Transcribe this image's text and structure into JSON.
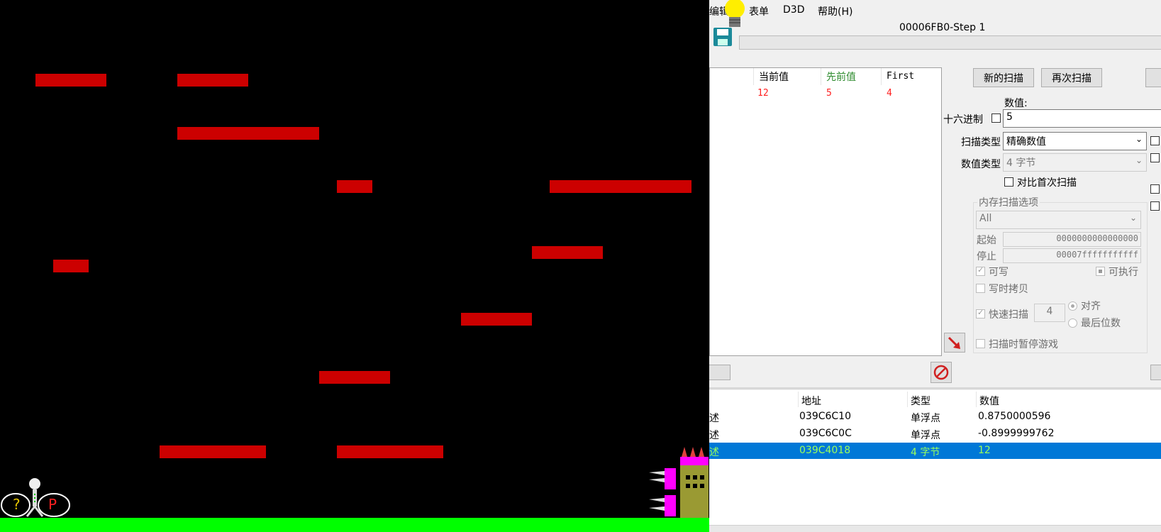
{
  "menu": {
    "edit": "编辑",
    "table": "表单",
    "d3d": "D3D",
    "help": "帮助(H)"
  },
  "window_title": "00006FB0-Step 1",
  "results": {
    "headers": {
      "current": "当前值",
      "previous": "先前值",
      "first": "First"
    },
    "rows": [
      {
        "current": "12",
        "previous": "5",
        "first": "4"
      }
    ]
  },
  "scan": {
    "new_scan": "新的扫描",
    "next_scan": "再次扫描",
    "value_label": "数值:",
    "hex_label": "十六进制",
    "value": "5",
    "scan_type_label": "扫描类型",
    "scan_type": "精确数值",
    "value_type_label": "数值类型",
    "value_type": "4 字节",
    "compare_first": "对比首次扫描",
    "mem_options": "内存扫描选项",
    "region": "All",
    "start_label": "起始",
    "start_value": "0000000000000000",
    "stop_label": "停止",
    "stop_value": "00007fffffffffff",
    "writable": "可写",
    "executable": "可执行",
    "copy_on_write": "写时拷贝",
    "fast_scan": "快速扫描",
    "fast_scan_value": "4",
    "align": "对齐",
    "last_digits": "最后位数",
    "pause_game": "扫描时暂停游戏"
  },
  "address_list": {
    "headers": {
      "address": "地址",
      "type": "类型",
      "value": "数值"
    },
    "rows": [
      {
        "desc": "述",
        "address": "039C6C10",
        "type": "单浮点",
        "value": "0.8750000596"
      },
      {
        "desc": "述",
        "address": "039C6C0C",
        "type": "单浮点",
        "value": "-0.8999999762"
      },
      {
        "desc": "述",
        "address": "039C4018",
        "type": "4 字节",
        "value": "12"
      }
    ]
  },
  "game": {
    "hud_question": "?",
    "hud_p": "P"
  },
  "colors": {
    "platform": "#cc0000",
    "ground": "#00ff00",
    "selected_row": "#0078d7",
    "selected_text": "#9cff5c"
  }
}
